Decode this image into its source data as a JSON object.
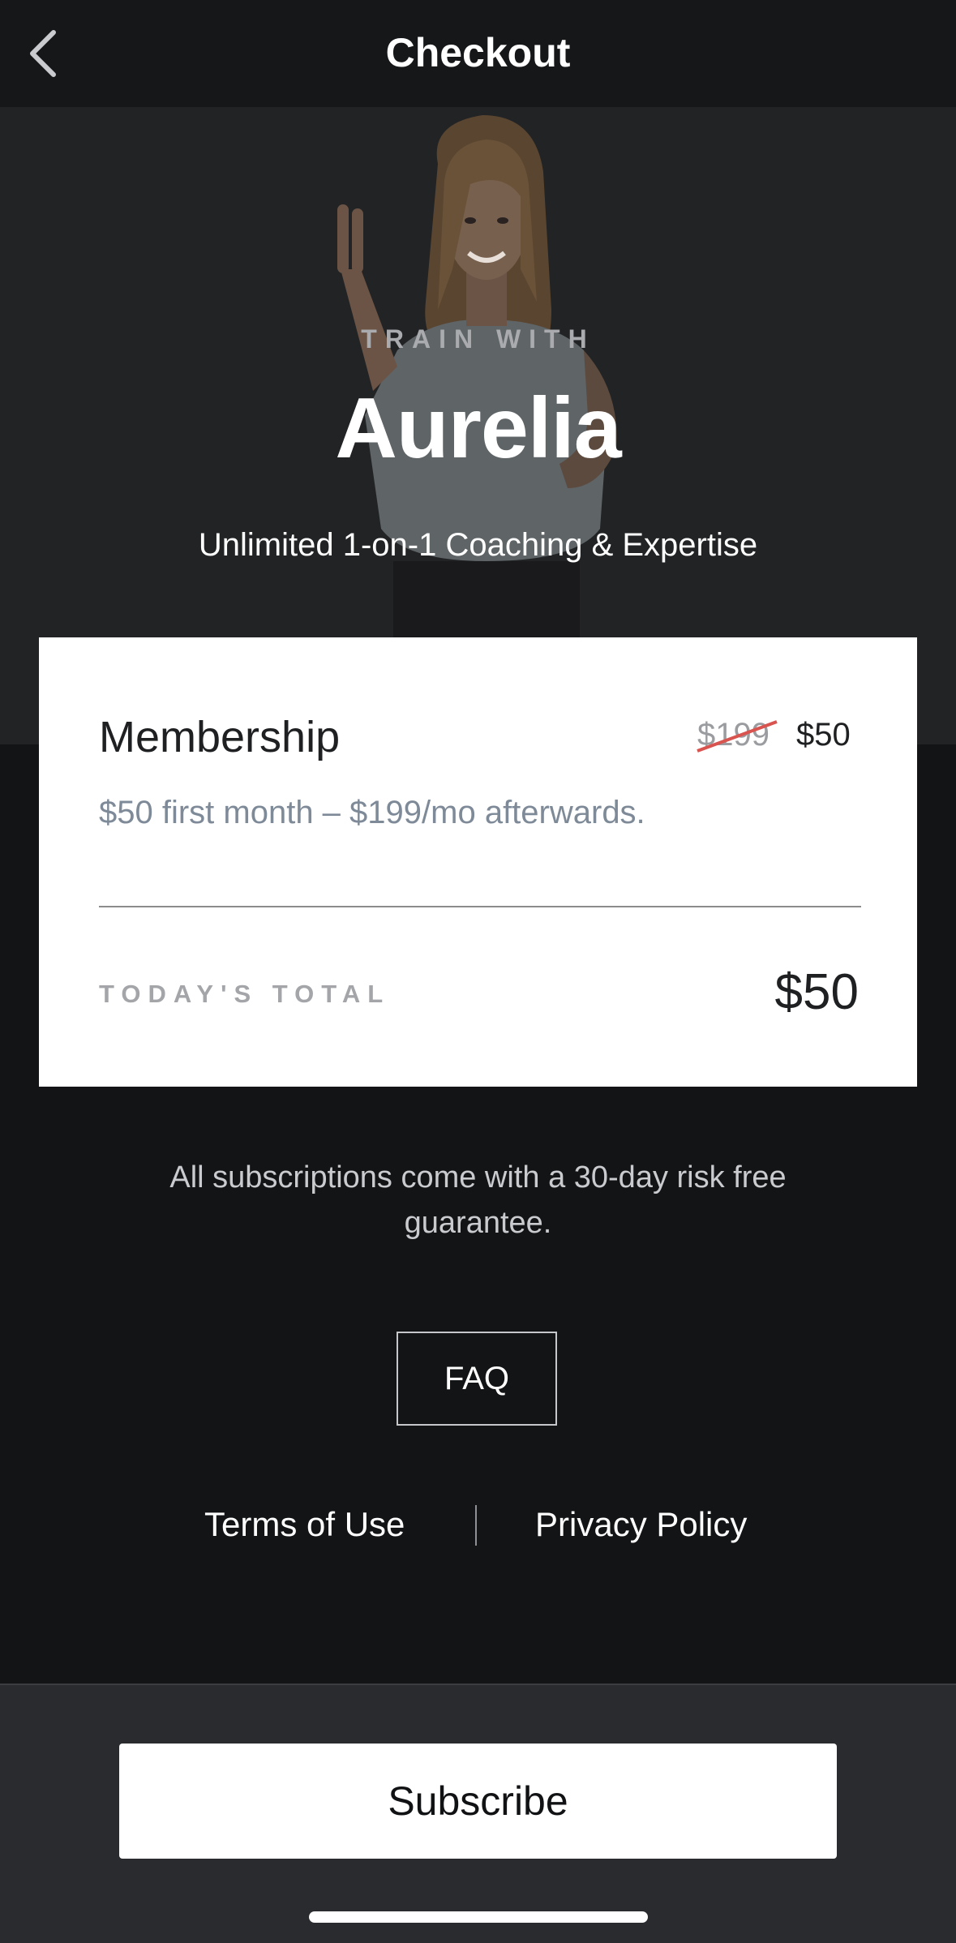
{
  "navbar": {
    "title": "Checkout",
    "back_icon": "chevron-left-icon"
  },
  "hero": {
    "eyebrow": "TRAIN WITH",
    "name": "Aurelia",
    "subtitle": "Unlimited 1-on-1 Coaching & Expertise"
  },
  "membership": {
    "title": "Membership",
    "original_price": "$199",
    "price": "$50",
    "description": "$50 first month – $199/mo afterwards.",
    "total_label": "TODAY'S TOTAL",
    "total_value": "$50"
  },
  "guarantee": "All subscriptions come with a 30-day risk free guarantee.",
  "faq_label": "FAQ",
  "links": {
    "terms": "Terms of Use",
    "privacy": "Privacy Policy"
  },
  "subscribe_label": "Subscribe",
  "colors": {
    "background": "#131416",
    "hero": "#222325",
    "card": "#ffffff",
    "strike": "#d9534f",
    "muted_text": "#7e8a98"
  }
}
